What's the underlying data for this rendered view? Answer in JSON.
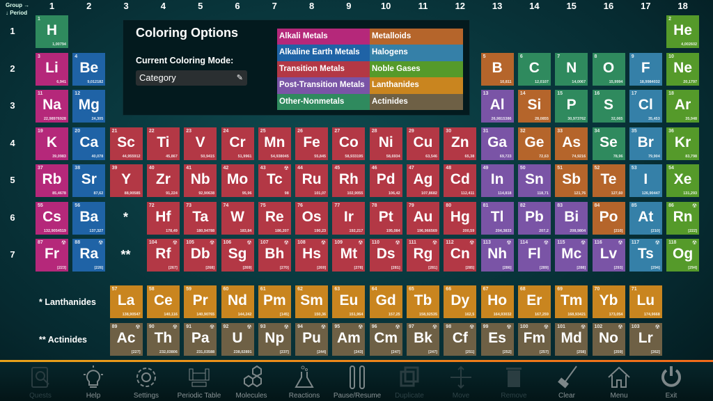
{
  "header": {
    "group_label": "Group →",
    "period_label": "↓ Period",
    "groups": [
      "1",
      "2",
      "3",
      "4",
      "5",
      "6",
      "7",
      "8",
      "9",
      "10",
      "11",
      "12",
      "13",
      "14",
      "15",
      "16",
      "17",
      "18"
    ],
    "periods": [
      "1",
      "2",
      "3",
      "4",
      "5",
      "6",
      "7"
    ]
  },
  "colors": {
    "alkali": "#b5287a",
    "alkaline": "#1f63a6",
    "transition": "#b33845",
    "post": "#7a54a6",
    "nonmetal": "#2f8a5e",
    "metalloid": "#b5652b",
    "halogen": "#3580a8",
    "noble": "#559a2a",
    "lanth": "#c9851f",
    "actin": "#6e6045"
  },
  "coloring_panel": {
    "title": "Coloring Options",
    "subtitle": "Current Coloring Mode:",
    "mode_value": "Category",
    "edit_icon": "pencil-icon",
    "legend": [
      {
        "label": "Alkali Metals",
        "cat": "alkali"
      },
      {
        "label": "Metalloids",
        "cat": "metalloid"
      },
      {
        "label": "Alkaline Earth Metals",
        "cat": "alkaline"
      },
      {
        "label": "Halogens",
        "cat": "halogen"
      },
      {
        "label": "Transition Metals",
        "cat": "transition"
      },
      {
        "label": "Noble Gases",
        "cat": "noble"
      },
      {
        "label": "Post-Transition Metals",
        "cat": "post"
      },
      {
        "label": "Lanthanides",
        "cat": "lanth"
      },
      {
        "label": "Other-Nonmetals",
        "cat": "nonmetal"
      },
      {
        "label": "Actinides",
        "cat": "actin"
      }
    ]
  },
  "placeholders": {
    "lanthanide_marker": "*",
    "actinide_marker": "**",
    "lanthanides_label": "* Lanthanides",
    "actinides_label": "** Actinides"
  },
  "elements": [
    {
      "n": 1,
      "s": "H",
      "m": "1,00794",
      "g": 1,
      "p": 1,
      "c": "nonmetal"
    },
    {
      "n": 2,
      "s": "He",
      "m": "4,002602",
      "g": 18,
      "p": 1,
      "c": "noble"
    },
    {
      "n": 3,
      "s": "Li",
      "m": "6,941",
      "g": 1,
      "p": 2,
      "c": "alkali"
    },
    {
      "n": 4,
      "s": "Be",
      "m": "9,012182",
      "g": 2,
      "p": 2,
      "c": "alkaline"
    },
    {
      "n": 5,
      "s": "B",
      "m": "10,811",
      "g": 13,
      "p": 2,
      "c": "metalloid"
    },
    {
      "n": 6,
      "s": "C",
      "m": "12,0107",
      "g": 14,
      "p": 2,
      "c": "nonmetal"
    },
    {
      "n": 7,
      "s": "N",
      "m": "14,0067",
      "g": 15,
      "p": 2,
      "c": "nonmetal"
    },
    {
      "n": 8,
      "s": "O",
      "m": "15,9994",
      "g": 16,
      "p": 2,
      "c": "nonmetal"
    },
    {
      "n": 9,
      "s": "F",
      "m": "18,9984032",
      "g": 17,
      "p": 2,
      "c": "halogen"
    },
    {
      "n": 10,
      "s": "Ne",
      "m": "20,1797",
      "g": 18,
      "p": 2,
      "c": "noble"
    },
    {
      "n": 11,
      "s": "Na",
      "m": "22,98976928",
      "g": 1,
      "p": 3,
      "c": "alkali"
    },
    {
      "n": 12,
      "s": "Mg",
      "m": "24,305",
      "g": 2,
      "p": 3,
      "c": "alkaline"
    },
    {
      "n": 13,
      "s": "Al",
      "m": "26,9815386",
      "g": 13,
      "p": 3,
      "c": "post"
    },
    {
      "n": 14,
      "s": "Si",
      "m": "28,0855",
      "g": 14,
      "p": 3,
      "c": "metalloid"
    },
    {
      "n": 15,
      "s": "P",
      "m": "30,973762",
      "g": 15,
      "p": 3,
      "c": "nonmetal"
    },
    {
      "n": 16,
      "s": "S",
      "m": "32,065",
      "g": 16,
      "p": 3,
      "c": "nonmetal"
    },
    {
      "n": 17,
      "s": "Cl",
      "m": "35,453",
      "g": 17,
      "p": 3,
      "c": "halogen"
    },
    {
      "n": 18,
      "s": "Ar",
      "m": "35,948",
      "g": 18,
      "p": 3,
      "c": "noble"
    },
    {
      "n": 19,
      "s": "K",
      "m": "39,0983",
      "g": 1,
      "p": 4,
      "c": "alkali"
    },
    {
      "n": 20,
      "s": "Ca",
      "m": "40,078",
      "g": 2,
      "p": 4,
      "c": "alkaline"
    },
    {
      "n": 21,
      "s": "Sc",
      "m": "44,955912",
      "g": 3,
      "p": 4,
      "c": "transition"
    },
    {
      "n": 22,
      "s": "Ti",
      "m": "45,867",
      "g": 4,
      "p": 4,
      "c": "transition"
    },
    {
      "n": 23,
      "s": "V",
      "m": "50,9415",
      "g": 5,
      "p": 4,
      "c": "transition"
    },
    {
      "n": 24,
      "s": "Cr",
      "m": "51,9961",
      "g": 6,
      "p": 4,
      "c": "transition"
    },
    {
      "n": 25,
      "s": "Mn",
      "m": "54,938045",
      "g": 7,
      "p": 4,
      "c": "transition"
    },
    {
      "n": 26,
      "s": "Fe",
      "m": "55,845",
      "g": 8,
      "p": 4,
      "c": "transition"
    },
    {
      "n": 27,
      "s": "Co",
      "m": "58,933195",
      "g": 9,
      "p": 4,
      "c": "transition"
    },
    {
      "n": 28,
      "s": "Ni",
      "m": "58,6934",
      "g": 10,
      "p": 4,
      "c": "transition"
    },
    {
      "n": 29,
      "s": "Cu",
      "m": "63,546",
      "g": 11,
      "p": 4,
      "c": "transition"
    },
    {
      "n": 30,
      "s": "Zn",
      "m": "65,38",
      "g": 12,
      "p": 4,
      "c": "transition"
    },
    {
      "n": 31,
      "s": "Ga",
      "m": "69,723",
      "g": 13,
      "p": 4,
      "c": "post"
    },
    {
      "n": 32,
      "s": "Ge",
      "m": "72,63",
      "g": 14,
      "p": 4,
      "c": "metalloid"
    },
    {
      "n": 33,
      "s": "As",
      "m": "74,9216",
      "g": 15,
      "p": 4,
      "c": "metalloid"
    },
    {
      "n": 34,
      "s": "Se",
      "m": "78,96",
      "g": 16,
      "p": 4,
      "c": "nonmetal"
    },
    {
      "n": 35,
      "s": "Br",
      "m": "79,904",
      "g": 17,
      "p": 4,
      "c": "halogen"
    },
    {
      "n": 36,
      "s": "Kr",
      "m": "83,798",
      "g": 18,
      "p": 4,
      "c": "noble"
    },
    {
      "n": 37,
      "s": "Rb",
      "m": "85,4678",
      "g": 1,
      "p": 5,
      "c": "alkali"
    },
    {
      "n": 38,
      "s": "Sr",
      "m": "87,62",
      "g": 2,
      "p": 5,
      "c": "alkaline"
    },
    {
      "n": 39,
      "s": "Y",
      "m": "88,90585",
      "g": 3,
      "p": 5,
      "c": "transition"
    },
    {
      "n": 40,
      "s": "Zr",
      "m": "91,224",
      "g": 4,
      "p": 5,
      "c": "transition"
    },
    {
      "n": 41,
      "s": "Nb",
      "m": "92,90638",
      "g": 5,
      "p": 5,
      "c": "transition"
    },
    {
      "n": 42,
      "s": "Mo",
      "m": "95,96",
      "g": 6,
      "p": 5,
      "c": "transition"
    },
    {
      "n": 43,
      "s": "Tc",
      "m": "98",
      "g": 7,
      "p": 5,
      "c": "transition",
      "r": true
    },
    {
      "n": 44,
      "s": "Ru",
      "m": "101,07",
      "g": 8,
      "p": 5,
      "c": "transition"
    },
    {
      "n": 45,
      "s": "Rh",
      "m": "102,9055",
      "g": 9,
      "p": 5,
      "c": "transition"
    },
    {
      "n": 46,
      "s": "Pd",
      "m": "106,42",
      "g": 10,
      "p": 5,
      "c": "transition"
    },
    {
      "n": 47,
      "s": "Ag",
      "m": "107,8682",
      "g": 11,
      "p": 5,
      "c": "transition"
    },
    {
      "n": 48,
      "s": "Cd",
      "m": "112,411",
      "g": 12,
      "p": 5,
      "c": "transition"
    },
    {
      "n": 49,
      "s": "In",
      "m": "114,818",
      "g": 13,
      "p": 5,
      "c": "post"
    },
    {
      "n": 50,
      "s": "Sn",
      "m": "118,71",
      "g": 14,
      "p": 5,
      "c": "post"
    },
    {
      "n": 51,
      "s": "Sb",
      "m": "121,76",
      "g": 15,
      "p": 5,
      "c": "metalloid"
    },
    {
      "n": 52,
      "s": "Te",
      "m": "127,60",
      "g": 16,
      "p": 5,
      "c": "metalloid"
    },
    {
      "n": 53,
      "s": "I",
      "m": "126,90447",
      "g": 17,
      "p": 5,
      "c": "halogen"
    },
    {
      "n": 54,
      "s": "Xe",
      "m": "131,293",
      "g": 18,
      "p": 5,
      "c": "noble"
    },
    {
      "n": 55,
      "s": "Cs",
      "m": "132,9054519",
      "g": 1,
      "p": 6,
      "c": "alkali"
    },
    {
      "n": 56,
      "s": "Ba",
      "m": "137,327",
      "g": 2,
      "p": 6,
      "c": "alkaline"
    },
    {
      "n": 72,
      "s": "Hf",
      "m": "178,49",
      "g": 4,
      "p": 6,
      "c": "transition"
    },
    {
      "n": 73,
      "s": "Ta",
      "m": "180,94788",
      "g": 5,
      "p": 6,
      "c": "transition"
    },
    {
      "n": 74,
      "s": "W",
      "m": "183,84",
      "g": 6,
      "p": 6,
      "c": "transition"
    },
    {
      "n": 75,
      "s": "Re",
      "m": "186,207",
      "g": 7,
      "p": 6,
      "c": "transition"
    },
    {
      "n": 76,
      "s": "Os",
      "m": "190,23",
      "g": 8,
      "p": 6,
      "c": "transition"
    },
    {
      "n": 77,
      "s": "Ir",
      "m": "192,217",
      "g": 9,
      "p": 6,
      "c": "transition"
    },
    {
      "n": 78,
      "s": "Pt",
      "m": "195,084",
      "g": 10,
      "p": 6,
      "c": "transition"
    },
    {
      "n": 79,
      "s": "Au",
      "m": "196,966569",
      "g": 11,
      "p": 6,
      "c": "transition"
    },
    {
      "n": 80,
      "s": "Hg",
      "m": "200,59",
      "g": 12,
      "p": 6,
      "c": "transition"
    },
    {
      "n": 81,
      "s": "Tl",
      "m": "204,3833",
      "g": 13,
      "p": 6,
      "c": "post"
    },
    {
      "n": 82,
      "s": "Pb",
      "m": "207,2",
      "g": 14,
      "p": 6,
      "c": "post"
    },
    {
      "n": 83,
      "s": "Bi",
      "m": "208,9804",
      "g": 15,
      "p": 6,
      "c": "post"
    },
    {
      "n": 84,
      "s": "Po",
      "m": "[210]",
      "g": 16,
      "p": 6,
      "c": "metalloid"
    },
    {
      "n": 85,
      "s": "At",
      "m": "[210]",
      "g": 17,
      "p": 6,
      "c": "halogen"
    },
    {
      "n": 86,
      "s": "Rn",
      "m": "[222]",
      "g": 18,
      "p": 6,
      "c": "noble",
      "r": true
    },
    {
      "n": 87,
      "s": "Fr",
      "m": "[223]",
      "g": 1,
      "p": 7,
      "c": "alkali",
      "r": true
    },
    {
      "n": 88,
      "s": "Ra",
      "m": "[226]",
      "g": 2,
      "p": 7,
      "c": "alkaline",
      "r": true
    },
    {
      "n": 104,
      "s": "Rf",
      "m": "[267]",
      "g": 4,
      "p": 7,
      "c": "transition",
      "r": true
    },
    {
      "n": 105,
      "s": "Db",
      "m": "[268]",
      "g": 5,
      "p": 7,
      "c": "transition",
      "r": true
    },
    {
      "n": 106,
      "s": "Sg",
      "m": "[269]",
      "g": 6,
      "p": 7,
      "c": "transition",
      "r": true
    },
    {
      "n": 107,
      "s": "Bh",
      "m": "[270]",
      "g": 7,
      "p": 7,
      "c": "transition",
      "r": true
    },
    {
      "n": 108,
      "s": "Hs",
      "m": "[269]",
      "g": 8,
      "p": 7,
      "c": "transition",
      "r": true
    },
    {
      "n": 109,
      "s": "Mt",
      "m": "[278]",
      "g": 9,
      "p": 7,
      "c": "transition",
      "r": true
    },
    {
      "n": 110,
      "s": "Ds",
      "m": "[281]",
      "g": 10,
      "p": 7,
      "c": "transition",
      "r": true
    },
    {
      "n": 111,
      "s": "Rg",
      "m": "[281]",
      "g": 11,
      "p": 7,
      "c": "transition",
      "r": true
    },
    {
      "n": 112,
      "s": "Cn",
      "m": "[285]",
      "g": 12,
      "p": 7,
      "c": "transition",
      "r": true
    },
    {
      "n": 113,
      "s": "Nh",
      "m": "[286]",
      "g": 13,
      "p": 7,
      "c": "post",
      "r": true
    },
    {
      "n": 114,
      "s": "Fl",
      "m": "[289]",
      "g": 14,
      "p": 7,
      "c": "post",
      "r": true
    },
    {
      "n": 115,
      "s": "Mc",
      "m": "[288]",
      "g": 15,
      "p": 7,
      "c": "post",
      "r": true
    },
    {
      "n": 116,
      "s": "Lv",
      "m": "[293]",
      "g": 16,
      "p": 7,
      "c": "post",
      "r": true
    },
    {
      "n": 117,
      "s": "Ts",
      "m": "[294]",
      "g": 17,
      "p": 7,
      "c": "halogen",
      "r": true
    },
    {
      "n": 118,
      "s": "Og",
      "m": "[294]",
      "g": 18,
      "p": 7,
      "c": "noble",
      "r": true
    },
    {
      "n": 57,
      "s": "La",
      "m": "138,90547",
      "g": 3,
      "p": 8,
      "c": "lanth"
    },
    {
      "n": 58,
      "s": "Ce",
      "m": "140,116",
      "g": 4,
      "p": 8,
      "c": "lanth"
    },
    {
      "n": 59,
      "s": "Pr",
      "m": "140,90765",
      "g": 5,
      "p": 8,
      "c": "lanth"
    },
    {
      "n": 60,
      "s": "Nd",
      "m": "144,242",
      "g": 6,
      "p": 8,
      "c": "lanth"
    },
    {
      "n": 61,
      "s": "Pm",
      "m": "[145]",
      "g": 7,
      "p": 8,
      "c": "lanth"
    },
    {
      "n": 62,
      "s": "Sm",
      "m": "150,36",
      "g": 8,
      "p": 8,
      "c": "lanth"
    },
    {
      "n": 63,
      "s": "Eu",
      "m": "151,964",
      "g": 9,
      "p": 8,
      "c": "lanth"
    },
    {
      "n": 64,
      "s": "Gd",
      "m": "157,25",
      "g": 10,
      "p": 8,
      "c": "lanth"
    },
    {
      "n": 65,
      "s": "Tb",
      "m": "158,92535",
      "g": 11,
      "p": 8,
      "c": "lanth"
    },
    {
      "n": 66,
      "s": "Dy",
      "m": "162,5",
      "g": 12,
      "p": 8,
      "c": "lanth"
    },
    {
      "n": 67,
      "s": "Ho",
      "m": "164,93032",
      "g": 13,
      "p": 8,
      "c": "lanth"
    },
    {
      "n": 68,
      "s": "Er",
      "m": "167,259",
      "g": 14,
      "p": 8,
      "c": "lanth"
    },
    {
      "n": 69,
      "s": "Tm",
      "m": "168,93421",
      "g": 15,
      "p": 8,
      "c": "lanth"
    },
    {
      "n": 70,
      "s": "Yb",
      "m": "173,054",
      "g": 16,
      "p": 8,
      "c": "lanth"
    },
    {
      "n": 71,
      "s": "Lu",
      "m": "174,9668",
      "g": 17,
      "p": 8,
      "c": "lanth"
    },
    {
      "n": 89,
      "s": "Ac",
      "m": "[227]",
      "g": 3,
      "p": 9,
      "c": "actin",
      "r": true
    },
    {
      "n": 90,
      "s": "Th",
      "m": "232,03806",
      "g": 4,
      "p": 9,
      "c": "actin",
      "r": true
    },
    {
      "n": 91,
      "s": "Pa",
      "m": "231,03588",
      "g": 5,
      "p": 9,
      "c": "actin",
      "r": true
    },
    {
      "n": 92,
      "s": "U",
      "m": "238,02891",
      "g": 6,
      "p": 9,
      "c": "actin",
      "r": true
    },
    {
      "n": 93,
      "s": "Np",
      "m": "[237]",
      "g": 7,
      "p": 9,
      "c": "actin",
      "r": true
    },
    {
      "n": 94,
      "s": "Pu",
      "m": "[244]",
      "g": 8,
      "p": 9,
      "c": "actin",
      "r": true
    },
    {
      "n": 95,
      "s": "Am",
      "m": "[243]",
      "g": 9,
      "p": 9,
      "c": "actin",
      "r": true
    },
    {
      "n": 96,
      "s": "Cm",
      "m": "[247]",
      "g": 10,
      "p": 9,
      "c": "actin",
      "r": true
    },
    {
      "n": 97,
      "s": "Bk",
      "m": "[247]",
      "g": 11,
      "p": 9,
      "c": "actin",
      "r": true
    },
    {
      "n": 98,
      "s": "Cf",
      "m": "[251]",
      "g": 12,
      "p": 9,
      "c": "actin",
      "r": true
    },
    {
      "n": 99,
      "s": "Es",
      "m": "[252]",
      "g": 13,
      "p": 9,
      "c": "actin",
      "r": true
    },
    {
      "n": 100,
      "s": "Fm",
      "m": "[257]",
      "g": 14,
      "p": 9,
      "c": "actin",
      "r": true
    },
    {
      "n": 101,
      "s": "Md",
      "m": "[258]",
      "g": 15,
      "p": 9,
      "c": "actin",
      "r": true
    },
    {
      "n": 102,
      "s": "No",
      "m": "[259]",
      "g": 16,
      "p": 9,
      "c": "actin",
      "r": true
    },
    {
      "n": 103,
      "s": "Lr",
      "m": "[262]",
      "g": 17,
      "p": 9,
      "c": "actin",
      "r": true
    }
  ],
  "radioactive_icon": "☢",
  "toolbar": [
    {
      "label": "Quests",
      "icon": "quests-icon",
      "enabled": false
    },
    {
      "label": "Help",
      "icon": "lightbulb-icon",
      "enabled": true
    },
    {
      "label": "Settings",
      "icon": "gear-icon",
      "enabled": true
    },
    {
      "label": "Periodic Table",
      "icon": "periodic-table-icon",
      "enabled": true
    },
    {
      "label": "Molecules",
      "icon": "molecule-icon",
      "enabled": true
    },
    {
      "label": "Reactions",
      "icon": "flask-icon",
      "enabled": true
    },
    {
      "label": "Pause/Resume",
      "icon": "pause-icon",
      "enabled": true
    },
    {
      "label": "Duplicate",
      "icon": "duplicate-icon",
      "enabled": false
    },
    {
      "label": "Move",
      "icon": "move-icon",
      "enabled": false
    },
    {
      "label": "Remove",
      "icon": "trash-icon",
      "enabled": false
    },
    {
      "label": "Clear",
      "icon": "broom-icon",
      "enabled": true
    },
    {
      "label": "Menu",
      "icon": "home-icon",
      "enabled": true
    },
    {
      "label": "Exit",
      "icon": "power-icon",
      "enabled": true
    }
  ]
}
